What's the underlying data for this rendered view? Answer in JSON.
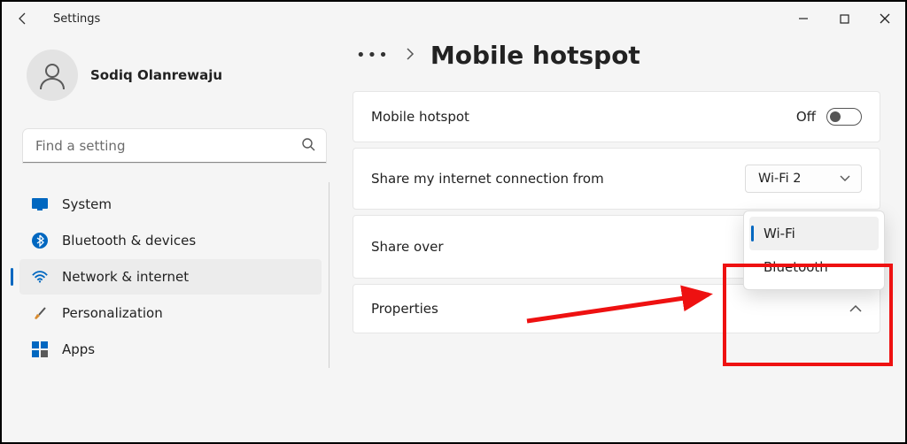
{
  "window": {
    "title": "Settings"
  },
  "profile": {
    "name": "Sodiq Olanrewaju"
  },
  "search": {
    "placeholder": "Find a setting"
  },
  "sidebar": {
    "items": [
      {
        "label": "System"
      },
      {
        "label": "Bluetooth & devices"
      },
      {
        "label": "Network & internet"
      },
      {
        "label": "Personalization"
      },
      {
        "label": "Apps"
      }
    ]
  },
  "breadcrumb": {
    "title": "Mobile hotspot"
  },
  "hotspot": {
    "label": "Mobile hotspot",
    "state_text": "Off"
  },
  "share_from": {
    "label": "Share my internet connection from",
    "selected": "Wi-Fi 2"
  },
  "share_over": {
    "label": "Share over",
    "options": [
      "Wi-Fi",
      "Bluetooth"
    ],
    "selected": "Wi-Fi"
  },
  "properties": {
    "label": "Properties"
  }
}
